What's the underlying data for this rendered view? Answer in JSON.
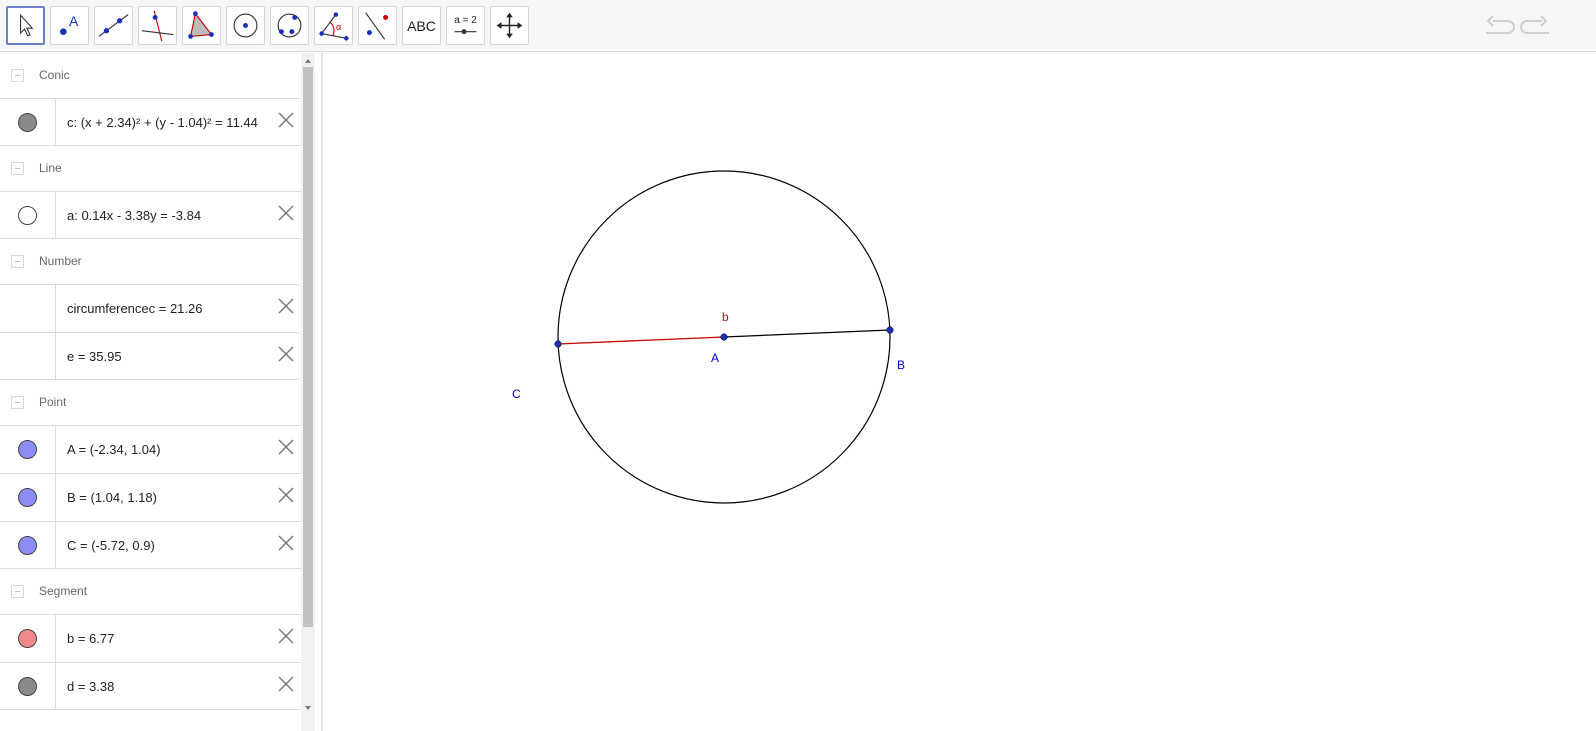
{
  "toolbar": {
    "tools": [
      {
        "name": "move-tool",
        "active": true
      },
      {
        "name": "point-tool",
        "icon_text": "A"
      },
      {
        "name": "line-tool"
      },
      {
        "name": "perpendicular-line-tool"
      },
      {
        "name": "polygon-tool"
      },
      {
        "name": "circle-center-point-tool"
      },
      {
        "name": "circle-three-points-tool"
      },
      {
        "name": "angle-tool",
        "icon_text": "α"
      },
      {
        "name": "reflect-tool"
      },
      {
        "name": "text-tool",
        "icon_text": "ABC"
      },
      {
        "name": "slider-tool",
        "icon_text": "a = 2"
      },
      {
        "name": "move-graphics-view-tool"
      }
    ],
    "undo_icon": "undo-icon",
    "redo_icon": "redo-icon"
  },
  "algebra": {
    "groups": [
      {
        "title": "Conic",
        "items": [
          {
            "definition": "c: (x + 2.34)² + (y - 1.04)² = 11.44",
            "marble_color": "#8a8a8a"
          }
        ]
      },
      {
        "title": "Line",
        "items": [
          {
            "definition": "a: 0.14x - 3.38y = -3.84",
            "marble_color": "#ffffff"
          }
        ]
      },
      {
        "title": "Number",
        "items": [
          {
            "definition": "circumferencec = 21.26",
            "marble_color": ""
          },
          {
            "definition": "e = 35.95",
            "marble_color": ""
          }
        ]
      },
      {
        "title": "Point",
        "items": [
          {
            "definition": "A = (-2.34, 1.04)",
            "marble_color": "#8c8cf7"
          },
          {
            "definition": "B = (1.04, 1.18)",
            "marble_color": "#8c8cf7"
          },
          {
            "definition": "C = (-5.72, 0.9)",
            "marble_color": "#8c8cf7"
          }
        ]
      },
      {
        "title": "Segment",
        "items": [
          {
            "definition": "b = 6.77",
            "marble_color": "#ef8a8a"
          },
          {
            "definition": "d = 3.38",
            "marble_color": "#8a8a8a"
          }
        ]
      }
    ]
  },
  "graphics": {
    "labels": {
      "A": "A",
      "B": "B",
      "C": "C",
      "b": "b"
    },
    "colors": {
      "point": "#0000cc",
      "segment_b": "#cc0000",
      "circle": "#000000",
      "point_fill": "#1b2fb8"
    }
  }
}
